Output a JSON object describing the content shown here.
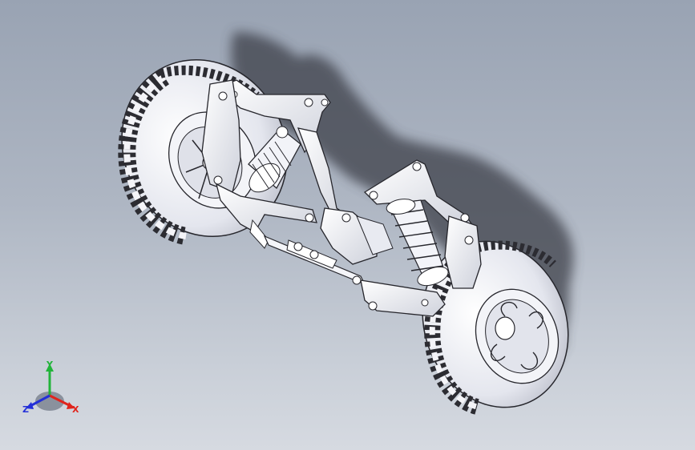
{
  "viewport": {
    "background_top": "#99a3b3",
    "background_bottom": "#d6dae1"
  },
  "model": {
    "part_color": "#eceef4",
    "edge_color": "#26262c",
    "shadow_color": "#3c4048"
  },
  "triad": {
    "labels": {
      "x": "X",
      "y": "Y",
      "z": "Z"
    },
    "colors": {
      "x": "#e0241c",
      "y": "#22b43a",
      "z": "#2430d8"
    }
  }
}
